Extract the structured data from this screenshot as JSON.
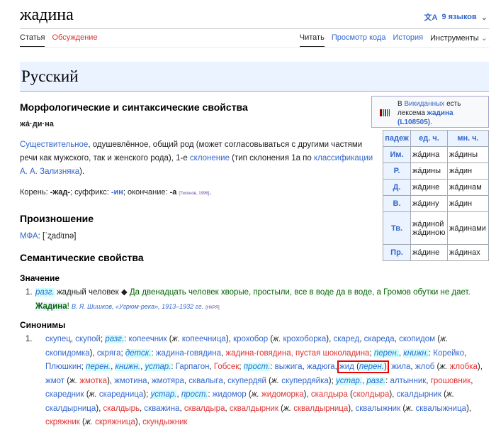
{
  "header": {
    "title": "жадина",
    "languages": "9 языков"
  },
  "tabs_left": [
    "Статья",
    "Обсуждение"
  ],
  "tabs_right": [
    "Читать",
    "Просмотр кода",
    "История",
    "Инструменты"
  ],
  "language_heading": "Русский",
  "morph": {
    "heading": "Морфологические и синтаксические свойства",
    "syllables": "жа́·ди·на",
    "pos_link": "Существительное",
    "pos_text": ", одушевлённое, общий род (может согласовываться с другими частями речи как мужского, так и женского рода), 1-е ",
    "decl_link": "склонение",
    "decl_text": " (тип склонения 1a по ",
    "class_link": "классификации А. А. Зализняка",
    "end": ").",
    "root_label": "Корень: ",
    "root": "-жад-",
    "suffix_label": "; суффикс: ",
    "suffix": "-ин",
    "ending_label": "; окончание: ",
    "ending": "-а",
    "ref": "[Тихонов, 1996]",
    "dot": "."
  },
  "wikidata": {
    "pre": "В ",
    "link": "Викиданных",
    "mid": " есть лексема ",
    "lexeme": "жадина (L108505)",
    "post": "."
  },
  "table": {
    "headers": [
      "падеж",
      "ед. ч.",
      "мн. ч."
    ],
    "rows": [
      [
        "Им.",
        "жа́дина",
        "жа́дины"
      ],
      [
        "Р.",
        "жа́дины",
        "жа́дин"
      ],
      [
        "Д.",
        "жа́дине",
        "жа́динам"
      ],
      [
        "В.",
        "жа́дину",
        "жа́дин"
      ],
      [
        "Тв.",
        "жа́диной жа́диною",
        "жа́динами"
      ],
      [
        "Пр.",
        "жа́дине",
        "жа́динах"
      ]
    ]
  },
  "pron": {
    "heading": "Произношение",
    "ipa_label": "МФА",
    "ipa": ": [ˈʐadʲɪnə]"
  },
  "sem": {
    "heading": "Семантические свойства",
    "meaning_heading": "Значение",
    "meaning": {
      "num": "1.",
      "label": "разг.",
      "def": " жадный человек ◆ ",
      "quote": "Да двенадцать человек хворые, простыли, все в воде да в воде, а Громов обутки не дает. ",
      "quote_bold": "Жадина",
      "quote_end": "! ",
      "source": "В. Я. Шишков, «Угрюм-река», 1913–1932 гг.",
      "corpus": "[НКРЯ]"
    },
    "syn_heading": "Синонимы",
    "syn_num": "1.",
    "synonyms": [
      [
        "b",
        "скупец"
      ],
      [
        "t",
        ", "
      ],
      [
        "b",
        "скупой"
      ],
      [
        "t",
        "; "
      ],
      [
        "l",
        "разг."
      ],
      [
        "t",
        ": "
      ],
      [
        "b",
        "копеечник"
      ],
      [
        "t",
        " ("
      ],
      [
        "i",
        "ж."
      ],
      [
        "t",
        " "
      ],
      [
        "b",
        "копеечница"
      ],
      [
        "t",
        "), "
      ],
      [
        "b",
        "крохобор"
      ],
      [
        "t",
        " ("
      ],
      [
        "i",
        "ж."
      ],
      [
        "t",
        " "
      ],
      [
        "b",
        "крохоборка"
      ],
      [
        "t",
        "), "
      ],
      [
        "b",
        "скаред"
      ],
      [
        "t",
        ", "
      ],
      [
        "b",
        "скареда"
      ],
      [
        "t",
        ", "
      ],
      [
        "b",
        "скопидом"
      ],
      [
        "t",
        " ("
      ],
      [
        "i",
        "ж."
      ],
      [
        "t",
        " "
      ],
      [
        "b",
        "скопидомка"
      ],
      [
        "t",
        "), "
      ],
      [
        "b",
        "скряга"
      ],
      [
        "t",
        "; "
      ],
      [
        "l",
        "детск."
      ],
      [
        "t",
        ": "
      ],
      [
        "b",
        "жадина-говядина"
      ],
      [
        "t",
        ", "
      ],
      [
        "r",
        "жадина-говядина, пустая шоколадина"
      ],
      [
        "t",
        "; "
      ],
      [
        "l",
        "перен."
      ],
      [
        "t",
        ", "
      ],
      [
        "l",
        "книжн."
      ],
      [
        "t",
        ": "
      ],
      [
        "b",
        "Корейко"
      ],
      [
        "t",
        ", "
      ],
      [
        "b",
        "Плюшкин"
      ],
      [
        "t",
        "; "
      ],
      [
        "l",
        "перен."
      ],
      [
        "t",
        ", "
      ],
      [
        "l",
        "книжн."
      ],
      [
        "t",
        ", "
      ],
      [
        "l",
        "устар."
      ],
      [
        "t",
        ": "
      ],
      [
        "b",
        "Гарпагон"
      ],
      [
        "t",
        ", "
      ],
      [
        "r",
        "Гобсек"
      ],
      [
        "t",
        "; "
      ],
      [
        "l",
        "прост."
      ],
      [
        "t",
        ": "
      ],
      [
        "b",
        "выжига"
      ],
      [
        "t",
        ", "
      ],
      [
        "b",
        "жадюга"
      ],
      [
        "t",
        ", "
      ],
      [
        "box",
        "жид"
      ],
      [
        "box_t",
        " ("
      ],
      [
        "box_l",
        "перен."
      ],
      [
        "box_t",
        ")"
      ],
      [
        "t",
        ", "
      ],
      [
        "b",
        "жила"
      ],
      [
        "t",
        ", "
      ],
      [
        "b",
        "жлоб"
      ],
      [
        "t",
        " ("
      ],
      [
        "i",
        "ж."
      ],
      [
        "t",
        " "
      ],
      [
        "r",
        "жлобка"
      ],
      [
        "t",
        "), "
      ],
      [
        "b",
        "жмот"
      ],
      [
        "t",
        " ("
      ],
      [
        "i",
        "ж."
      ],
      [
        "t",
        " "
      ],
      [
        "r",
        "жмотка"
      ],
      [
        "t",
        "), "
      ],
      [
        "b",
        "жмотина"
      ],
      [
        "t",
        ", "
      ],
      [
        "b",
        "жмотяра"
      ],
      [
        "t",
        ", "
      ],
      [
        "b",
        "сквалыга"
      ],
      [
        "t",
        ", "
      ],
      [
        "b",
        "скупердяй"
      ],
      [
        "t",
        " ("
      ],
      [
        "i",
        "ж."
      ],
      [
        "t",
        " "
      ],
      [
        "b",
        "скупердяйка"
      ],
      [
        "t",
        "); "
      ],
      [
        "l",
        "устар."
      ],
      [
        "t",
        ", "
      ],
      [
        "l",
        "разг."
      ],
      [
        "t",
        ": "
      ],
      [
        "b",
        "алтынник"
      ],
      [
        "t",
        ", "
      ],
      [
        "r",
        "грошовник"
      ],
      [
        "t",
        ", "
      ],
      [
        "b",
        "скаредник"
      ],
      [
        "t",
        " ("
      ],
      [
        "i",
        "ж."
      ],
      [
        "t",
        " "
      ],
      [
        "b",
        "скаредница"
      ],
      [
        "t",
        "); "
      ],
      [
        "l",
        "устар."
      ],
      [
        "t",
        ", "
      ],
      [
        "l",
        "прост."
      ],
      [
        "t",
        ": "
      ],
      [
        "b",
        "жидомор"
      ],
      [
        "t",
        " ("
      ],
      [
        "i",
        "ж."
      ],
      [
        "t",
        " "
      ],
      [
        "r",
        "жидоморка"
      ],
      [
        "t",
        "), "
      ],
      [
        "r",
        "скалдыра"
      ],
      [
        "t",
        " ("
      ],
      [
        "r",
        "сколдыра"
      ],
      [
        "t",
        "), "
      ],
      [
        "b",
        "скалдырник"
      ],
      [
        "t",
        " ("
      ],
      [
        "i",
        "ж."
      ],
      [
        "t",
        " "
      ],
      [
        "b",
        "скалдырница"
      ],
      [
        "t",
        "), "
      ],
      [
        "r",
        "скалдырь"
      ],
      [
        "t",
        ", "
      ],
      [
        "b",
        "скважина"
      ],
      [
        "t",
        ", "
      ],
      [
        "r",
        "сквалдыра"
      ],
      [
        "t",
        ", "
      ],
      [
        "r",
        "сквалдырник"
      ],
      [
        "t",
        " ("
      ],
      [
        "i",
        "ж."
      ],
      [
        "t",
        " "
      ],
      [
        "r",
        "сквалдырница"
      ],
      [
        "t",
        "), "
      ],
      [
        "b",
        "сквалыжник"
      ],
      [
        "t",
        " ("
      ],
      [
        "i",
        "ж."
      ],
      [
        "t",
        " "
      ],
      [
        "b",
        "сквалыжница"
      ],
      [
        "t",
        "), "
      ],
      [
        "r",
        "скряжник"
      ],
      [
        "t",
        " ("
      ],
      [
        "i",
        "ж."
      ],
      [
        "t",
        " "
      ],
      [
        "r",
        "скряжница"
      ],
      [
        "t",
        "), "
      ],
      [
        "r",
        "скундыжник"
      ]
    ]
  }
}
